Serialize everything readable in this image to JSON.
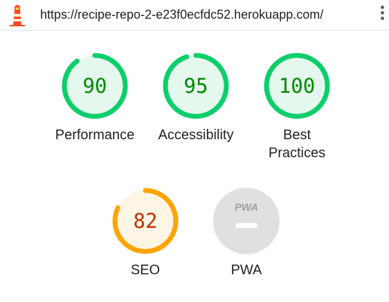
{
  "header": {
    "url": "https://recipe-repo-2-e23f0ecfdc52.herokuapp.com/",
    "logo_icon": "lighthouse-icon",
    "menu_icon": "kebab-menu-icon"
  },
  "colors": {
    "pass": "#0cce6b",
    "pass_fill": "#e5f8ee",
    "pass_text": "#008800",
    "average": "#ffa400",
    "average_fill": "#fff5e5",
    "average_text": "#c33300",
    "na": "#e0e0e0",
    "na_text": "#9e9e9e"
  },
  "gauges": [
    {
      "label": "Performance",
      "score": "90",
      "status": "pass"
    },
    {
      "label": "Accessibility",
      "score": "95",
      "status": "pass"
    },
    {
      "label": "Best Practices",
      "score": "100",
      "status": "pass"
    },
    {
      "label": "SEO",
      "score": "82",
      "status": "average"
    },
    {
      "label": "PWA",
      "badge_text": "PWA",
      "status": "na",
      "icon": "pwa-badge-icon"
    }
  ]
}
